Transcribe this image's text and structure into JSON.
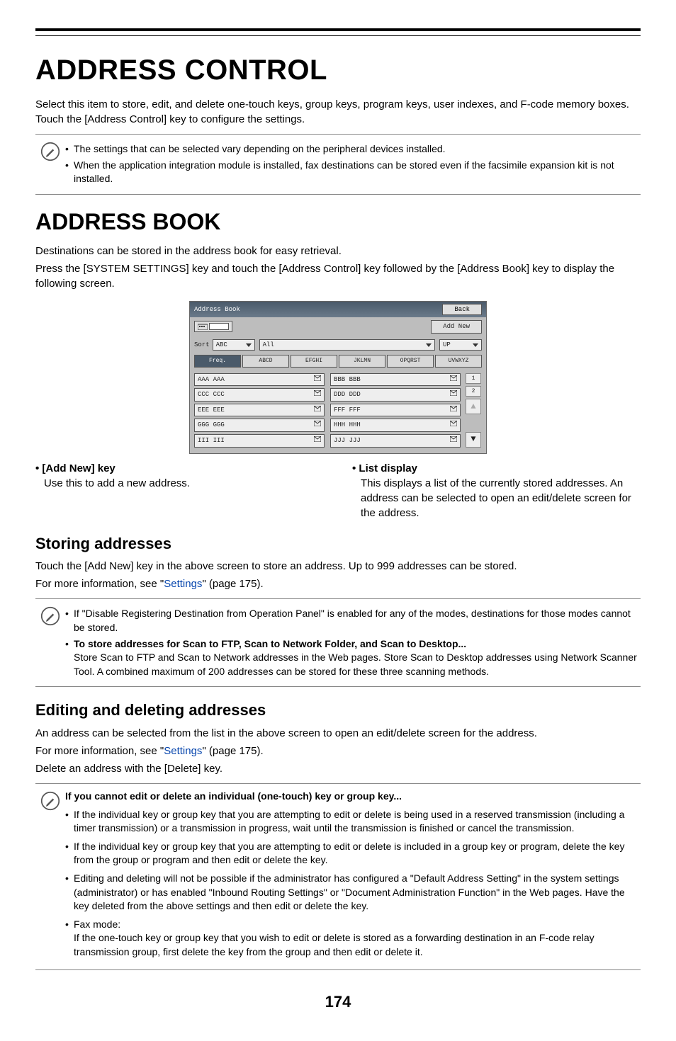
{
  "titles": {
    "main": "ADDRESS CONTROL",
    "section": "ADDRESS BOOK",
    "storing": "Storing addresses",
    "editing": "Editing and deleting addresses"
  },
  "intro": {
    "p1": "Select this item to store, edit, and delete one-touch keys, group keys, program keys, user indexes, and F-code memory boxes. Touch the [Address Control] key to configure the settings."
  },
  "note1": {
    "i1": "The settings that can be selected vary depending on the peripheral devices installed.",
    "i2": "When the application integration module is installed, fax destinations can be stored even if the facsimile expansion kit is not installed."
  },
  "addressbook": {
    "p1": "Destinations can be stored in the address book for easy retrieval.",
    "p2": "Press the [SYSTEM SETTINGS] key and touch the [Address Control] key followed by the [Address Book] key to display the following screen."
  },
  "mock": {
    "title": "Address Book",
    "back": "Back",
    "addnew": "Add New",
    "sort": "Sort",
    "sort_val": "ABC",
    "filter_val": "All",
    "up": "UP",
    "tabs": [
      "Freq.",
      "ABCD",
      "EFGHI",
      "JKLMN",
      "OPQRST",
      "UVWXYZ"
    ],
    "left": [
      "AAA AAA",
      "CCC CCC",
      "EEE EEE",
      "GGG GGG",
      "III III"
    ],
    "right": [
      "BBB BBB",
      "DDD DDD",
      "FFF FFF",
      "HHH HHH",
      "JJJ JJJ"
    ],
    "page1": "1",
    "page2": "2"
  },
  "defs": {
    "addnew_t": "• [Add New] key",
    "addnew_b": "Use this to add a new address.",
    "list_t": "• List display",
    "list_b": "This displays a list of the currently stored addresses. An address can be selected to open an edit/delete screen for the address."
  },
  "storing": {
    "p1": "Touch the [Add New] key in the above screen to store an address. Up to 999 addresses can be stored.",
    "p2a": "For more information, see \"",
    "link1": "Settings",
    "p2b": "\" (page 175)."
  },
  "note2": {
    "i1": "If \"Disable Registering Destination from Operation Panel\" is enabled for any of the modes, destinations for those modes cannot be stored.",
    "i2_bold": "To store addresses for Scan to FTP, Scan to Network Folder, and Scan to Desktop...",
    "i2_body": "Store Scan to FTP and Scan to Network addresses in the Web pages. Store Scan to Desktop addresses using Network Scanner Tool. A combined maximum of 200 addresses can be stored for these three scanning methods."
  },
  "editing": {
    "p1": "An address can be selected from the list in the above screen to open an edit/delete screen for the address.",
    "p2a": "For more information, see \"",
    "link2": "Settings",
    "p2b": "\" (page 175).",
    "p3": "Delete an address with the [Delete] key."
  },
  "note3": {
    "head": "If you cannot edit or delete an individual (one-touch) key or group key...",
    "i1": "If the individual key or group key that you are attempting to edit or delete is being used in a reserved transmission (including a timer transmission) or a transmission in progress, wait until the transmission is finished or cancel the transmission.",
    "i2": "If the individual key or group key that you are attempting to edit or delete is included in a group key or program, delete the key from the group or program and then edit or delete the key.",
    "i3": "Editing and deleting will not be possible if the administrator has configured a \"Default Address Setting\" in the system settings (administrator) or has enabled \"Inbound Routing Settings\" or \"Document Administration Function\" in the Web pages. Have the key deleted from the above settings and then edit or delete the key.",
    "i4": "Fax mode:",
    "i4b": "If the one-touch key or group key that you wish to edit or delete is stored as a forwarding destination in an F-code relay transmission group, first delete the key from the group and then edit or delete it."
  },
  "page_num": "174"
}
